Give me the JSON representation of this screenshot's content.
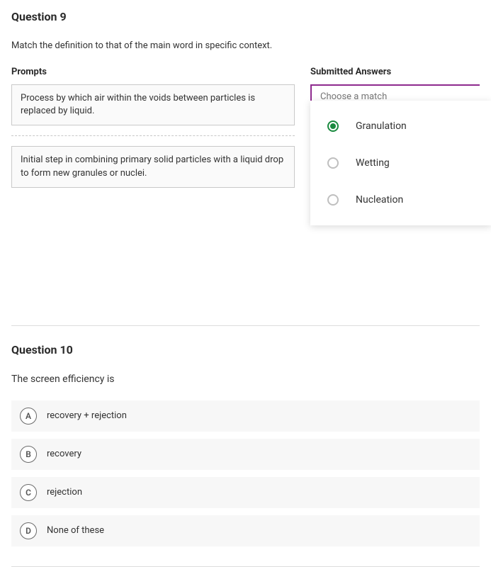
{
  "q9": {
    "title": "Question 9",
    "instruction": "Match the definition to that of the main word in specific context.",
    "prompts_header": "Prompts",
    "answers_header": "Submitted Answers",
    "prompts": [
      "Process by which air within the voids between particles is replaced by liquid.",
      "Initial step in combining primary solid particles with a liquid drop to form new granules or nuclei."
    ],
    "dropdown_placeholder": "Choose a match",
    "options": [
      {
        "label": "Granulation",
        "selected": true
      },
      {
        "label": "Wetting",
        "selected": false
      },
      {
        "label": "Nucleation",
        "selected": false
      }
    ]
  },
  "q10": {
    "title": "Question 10",
    "stem": "The screen efficiency is",
    "choices": [
      {
        "letter": "A",
        "text": "recovery + rejection"
      },
      {
        "letter": "B",
        "text": "recovery"
      },
      {
        "letter": "C",
        "text": "rejection"
      },
      {
        "letter": "D",
        "text": "None of these"
      }
    ]
  }
}
